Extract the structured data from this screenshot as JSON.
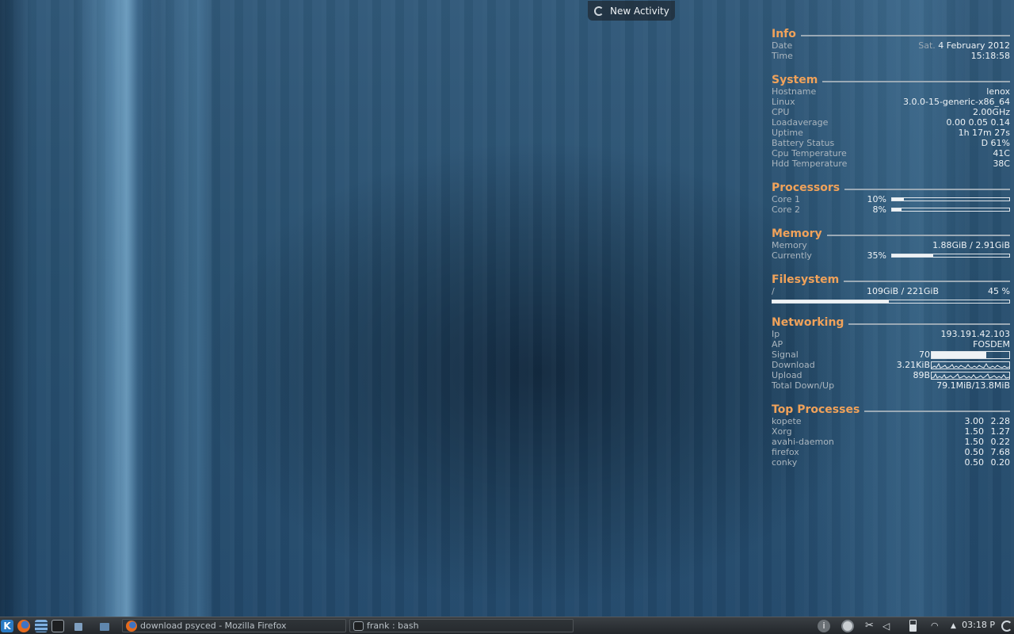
{
  "activity": {
    "label": "New Activity"
  },
  "info": {
    "title": "Info",
    "date_label": "Date",
    "date_day": "Sat.",
    "date_value": "4 February 2012",
    "time_label": "Time",
    "time_value": "15:18:58"
  },
  "system": {
    "title": "System",
    "rows": [
      {
        "label": "Hostname",
        "value": "lenox"
      },
      {
        "label": "Linux",
        "value": "3.0.0-15-generic-x86_64"
      },
      {
        "label": "CPU",
        "value": "2.00GHz"
      },
      {
        "label": "Loadaverage",
        "value": "0.00 0.05 0.14"
      },
      {
        "label": "Uptime",
        "value": "1h 17m 27s"
      },
      {
        "label": "Battery Status",
        "value": "D 61%"
      },
      {
        "label": "Cpu Temperature",
        "value": "41C"
      },
      {
        "label": "Hdd Temperature",
        "value": "38C"
      }
    ]
  },
  "processors": {
    "title": "Processors",
    "cores": [
      {
        "label": "Core 1",
        "percent": "10%",
        "fill": 0.1
      },
      {
        "label": "Core 2",
        "percent": "8%",
        "fill": 0.08
      }
    ]
  },
  "memory": {
    "title": "Memory",
    "memory_label": "Memory",
    "memory_value": "1.88GiB / 2.91GiB",
    "current_label": "Currently",
    "current_percent": "35%",
    "current_fill": 0.35
  },
  "filesystem": {
    "title": "Filesystem",
    "mount": "/",
    "usage": "109GiB / 221GiB",
    "percent": "45 %",
    "fill": 0.49
  },
  "networking": {
    "title": "Networking",
    "ip_label": "Ip",
    "ip_value": "193.191.42.103",
    "ap_label": "AP",
    "ap_value": "FOSDEM",
    "signal_label": "Signal",
    "signal_value": "70",
    "signal_fill": 0.7,
    "download_label": "Download",
    "download_value": "3.21KiB",
    "upload_label": "Upload",
    "upload_value": "89B",
    "total_label": "Total Down/Up",
    "total_value": "79.1MiB/13.8MiB"
  },
  "top": {
    "title": "Top Processes",
    "procs": [
      {
        "name": "kopete",
        "c1": "3.00",
        "c2": "2.28"
      },
      {
        "name": "Xorg",
        "c1": "1.50",
        "c2": "1.27"
      },
      {
        "name": "avahi-daemon",
        "c1": "1.50",
        "c2": "0.22"
      },
      {
        "name": "firefox",
        "c1": "0.50",
        "c2": "7.68"
      },
      {
        "name": "conky",
        "c1": "0.50",
        "c2": "0.20"
      }
    ]
  },
  "taskbar": {
    "tasks": [
      {
        "label": "download psyced - Mozilla Firefox"
      },
      {
        "label": "frank : bash"
      }
    ],
    "clock": "03:18 P"
  },
  "icons": {
    "kde": "kde-menu-icon",
    "firefox": "firefox-icon",
    "dolphin": "file-manager-icon",
    "terminal": "terminal-icon"
  }
}
